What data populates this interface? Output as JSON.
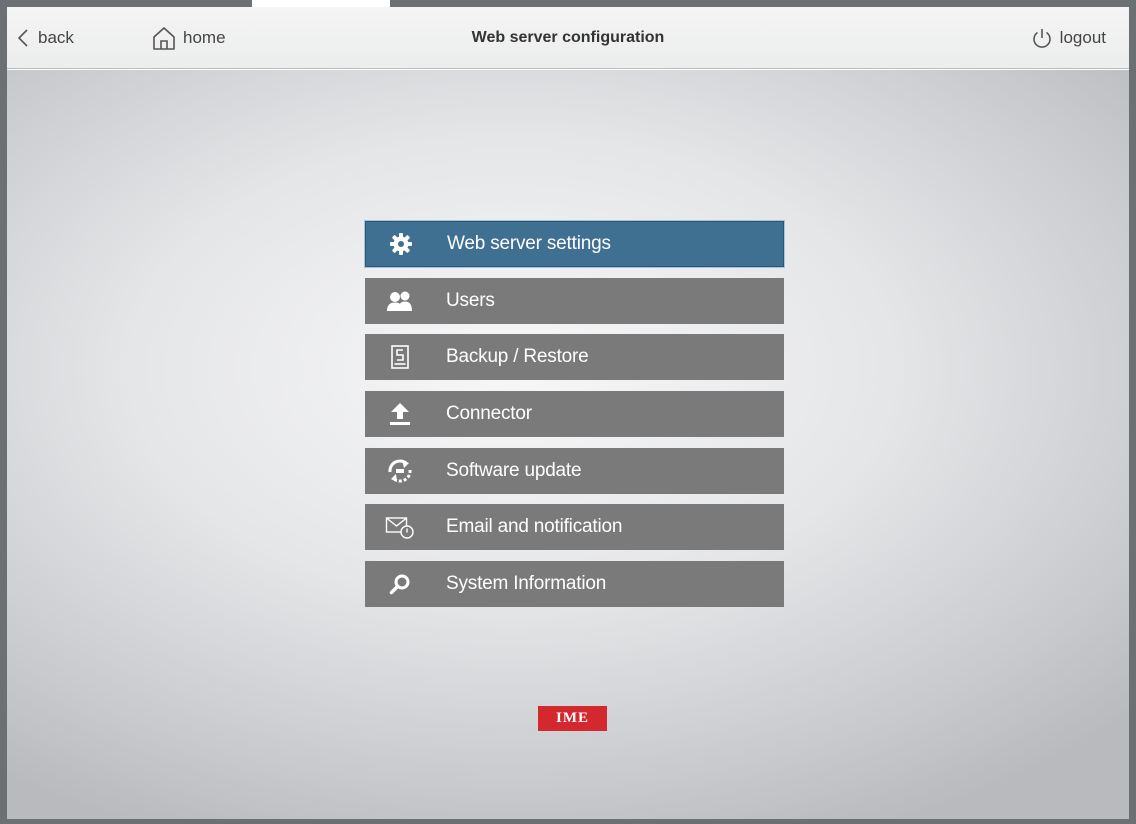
{
  "header": {
    "back_label": "back",
    "home_label": "home",
    "title": "Web server configuration",
    "logout_label": "logout"
  },
  "menu": {
    "items": [
      {
        "label": "Web server settings",
        "icon": "gear-icon",
        "active": true
      },
      {
        "label": "Users",
        "icon": "users-icon",
        "active": false
      },
      {
        "label": "Backup / Restore",
        "icon": "backup-drive-icon",
        "active": false
      },
      {
        "label": "Connector",
        "icon": "upload-icon",
        "active": false
      },
      {
        "label": "Software update",
        "icon": "refresh-icon",
        "active": false
      },
      {
        "label": "Email and notification",
        "icon": "email-clock-icon",
        "active": false
      },
      {
        "label": "System Information",
        "icon": "search-icon",
        "active": false
      }
    ]
  },
  "footer": {
    "logo_text": "IME"
  },
  "colors": {
    "active_item": "#3f6f91",
    "inactive_item": "#7a7a7a",
    "logo_red": "#d3282e",
    "frame": "#6d7073"
  }
}
